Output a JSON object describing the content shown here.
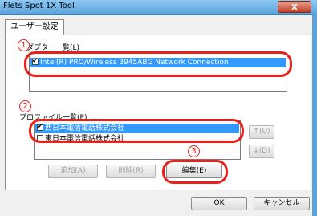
{
  "window": {
    "title": "Flets Spot 1X Tool",
    "close_label": "X"
  },
  "tabs": [
    {
      "label": "ユーザー設定"
    }
  ],
  "adapter_section": {
    "label": "アダプター一覧(L)",
    "items": [
      {
        "label": "Intel(R) PRO/Wireless 3945ABG Network Connection",
        "checked": true,
        "selected": true
      }
    ]
  },
  "profile_section": {
    "label": "プロファイル一覧(P)",
    "items": [
      {
        "label": "西日本電信電話株式会社",
        "checked": true,
        "selected": true
      },
      {
        "label": "東日本電信電話株式会社",
        "checked": false,
        "selected": false
      }
    ],
    "up_label": "↑(U)",
    "down_label": "↓(D)"
  },
  "buttons": {
    "add_label": "追加(A)",
    "delete_label": "削除(R)",
    "edit_label": "編集(E)",
    "ok_label": "OK",
    "cancel_label": "キャンセル"
  },
  "annotations": {
    "marker1": "1",
    "marker2": "2",
    "marker3": "3",
    "accent_color": "#e8201c"
  }
}
